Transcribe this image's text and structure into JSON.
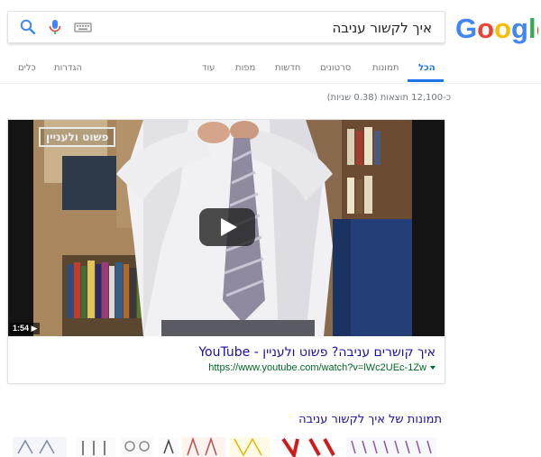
{
  "search": {
    "query": "איך לקשור עניבה"
  },
  "icons": {
    "search": "search-icon",
    "mic": "mic-icon",
    "keyboard": "keyboard-icon",
    "play": "play-icon"
  },
  "tabs": {
    "all": "הכל",
    "images": "תמונות",
    "videos": "סרטונים",
    "news": "חדשות",
    "maps": "מפות",
    "more": "עוד",
    "settings": "הגדרות",
    "tools": "כלים"
  },
  "stats": "כ-12,100 תוצאות (0.38 שניות)",
  "video_result": {
    "watermark": "פשוט ולעניין",
    "duration": "1:54",
    "title": "איך קושרים עניבה? פשוט ולעניין - YouTube",
    "url": "https://www.youtube.com/watch?v=lWc2UEc-1Zw"
  },
  "images_heading": "תמונות של איך לקשור עניבה",
  "colors": {
    "link": "#1a0dab",
    "url": "#006621",
    "accent": "#1a73e8"
  }
}
